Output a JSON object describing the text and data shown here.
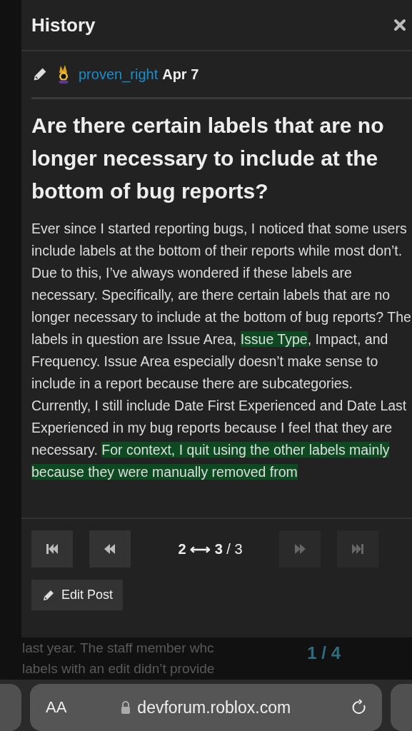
{
  "modal": {
    "title": "History",
    "revision": {
      "author": "proven_right",
      "date": "Apr 7"
    },
    "post_title": "Are there certain labels that are no longer necessary to include at the bottom of bug reports?",
    "body": [
      {
        "text": "Ever since I started reporting bugs, I noticed that some users include labels at the bottom of their reports while most don’t. Due to this, I’ve always wondered if these labels are necessary. Specifically, are there certain labels that are no longer necessary to include at the bottom of bug reports? The labels in question are Issue Area, ",
        "highlighted": false
      },
      {
        "text": "Issue Type",
        "highlighted": true
      },
      {
        "text": ", Impact, and Frequency. Issue Area especially doesn’t make sense to include in a report because there are subcategories. Currently, I still include Date First Experienced and Date Last Experienced in my bug reports because I feel that they are necessary. ",
        "highlighted": false
      },
      {
        "text": "For context, I quit using the other labels mainly because they were manually removed from",
        "highlighted": true
      }
    ],
    "nav_buttons": [
      {
        "kind": "first",
        "disabled": false
      },
      {
        "kind": "previous",
        "disabled": false
      },
      {
        "kind": "next",
        "disabled": true
      },
      {
        "kind": "last",
        "disabled": true
      }
    ],
    "counter": {
      "from": "2",
      "arrow": "⟷",
      "to": "3",
      "total": "/ 3"
    },
    "edit_button": "Edit Post"
  },
  "background": {
    "lines": [
      "last year. The staff member whc",
      "labels with an edit didn’t provide"
    ],
    "progress": "1 / 4"
  },
  "browser_bar": {
    "text_size": "AA",
    "url": "devforum.roblox.com"
  }
}
